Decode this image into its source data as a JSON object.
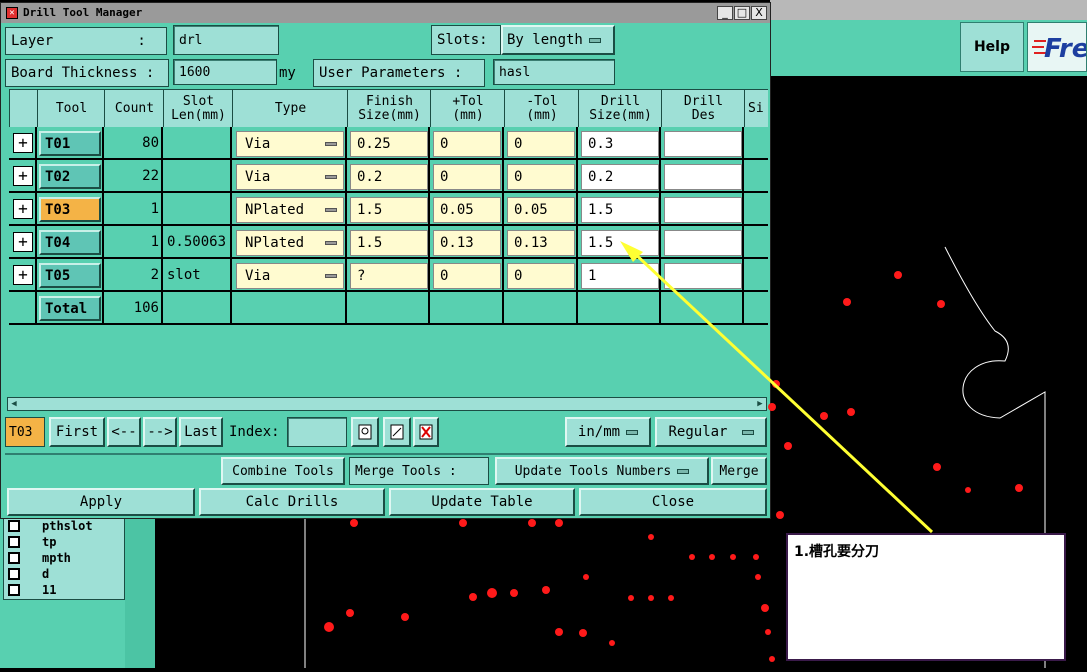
{
  "window": {
    "title": "Drill Tool Manager",
    "minimize": "_",
    "maximize": "□",
    "close": "X"
  },
  "background_app": {
    "help_label": "Help",
    "brand_text": "Fre",
    "layers": [
      "pthslot",
      "tp",
      "mpth",
      "d",
      "11"
    ]
  },
  "form": {
    "layer_label": "Layer          :",
    "layer_value": "drl",
    "slots_label": "Slots:",
    "slots_value": "By length",
    "board_thickness_label": "Board Thickness :",
    "board_thickness_value": "1600",
    "unit_label": "my",
    "user_params_label": "User Parameters :",
    "user_params_value": "hasl"
  },
  "table": {
    "headers": [
      "",
      "Tool",
      "Count",
      "Slot\nLen(mm)",
      "Type",
      "Finish\nSize(mm)",
      "+Tol\n(mm)",
      "-Tol\n(mm)",
      "Drill\nSize(mm)",
      "Drill\nDes",
      "Si"
    ],
    "rows": [
      {
        "tool": "T01",
        "count": "80",
        "slot_len": "",
        "type": "Via",
        "finish": "0.25",
        "ptol": "0",
        "mtol": "0",
        "drill": "0.3",
        "des": ""
      },
      {
        "tool": "T02",
        "count": "22",
        "slot_len": "",
        "type": "Via",
        "finish": "0.2",
        "ptol": "0",
        "mtol": "0",
        "drill": "0.2",
        "des": ""
      },
      {
        "tool": "T03",
        "count": "1",
        "slot_len": "",
        "type": "NPlated",
        "finish": "1.5",
        "ptol": "0.05",
        "mtol": "0.05",
        "drill": "1.5",
        "des": ""
      },
      {
        "tool": "T04",
        "count": "1",
        "slot_len": "0.50063",
        "type": "NPlated",
        "finish": "1.5",
        "ptol": "0.13",
        "mtol": "0.13",
        "drill": "1.5",
        "des": ""
      },
      {
        "tool": "T05",
        "count": "2",
        "slot_len": "slot",
        "type": "Via",
        "finish": "?",
        "ptol": "0",
        "mtol": "0",
        "drill": "1",
        "des": ""
      }
    ],
    "total_label": "Total",
    "total_count": "106",
    "selected_tool": "T03"
  },
  "nav": {
    "current": "T03",
    "first": "First",
    "prev": "<--",
    "next": "-->",
    "last": "Last",
    "index_label": "Index:",
    "index_value": "",
    "units": "in/mm",
    "mode": "Regular"
  },
  "tools": {
    "combine": "Combine Tools",
    "merge_label": "Merge Tools :",
    "update_numbers": "Update Tools Numbers",
    "merge": "Merge"
  },
  "actions": {
    "apply": "Apply",
    "calc": "Calc Drills",
    "update_table": "Update Table",
    "close": "Close"
  },
  "annotation": {
    "note": "1.槽孔要分刀"
  },
  "colors": {
    "panel": "#58d0b0",
    "widget": "#9ee0d6",
    "highlight": "#f4b346",
    "input_yellow": "#fffbd0",
    "drill_dot": "#ff1a1a",
    "arrow": "#ffff33"
  }
}
